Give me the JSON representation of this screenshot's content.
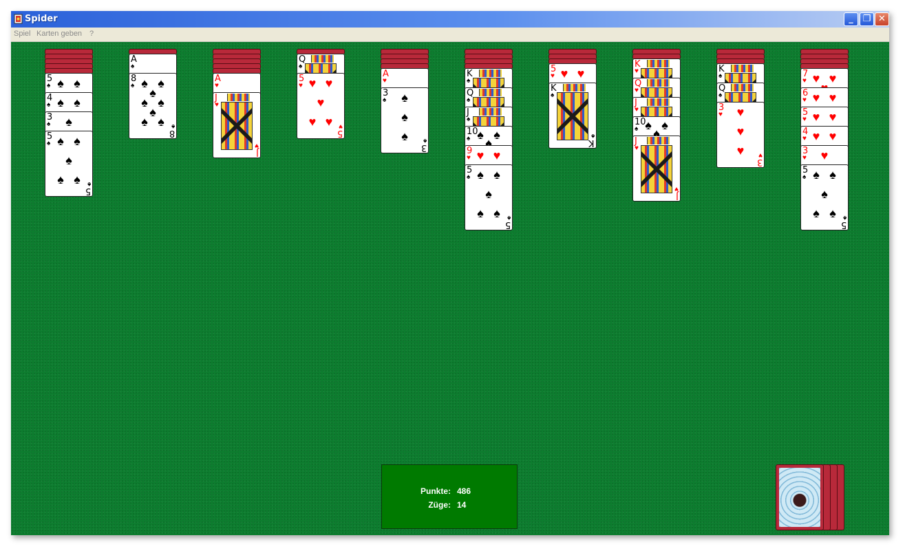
{
  "window": {
    "title": "Spider",
    "controls": {
      "minimize": "_",
      "maximize": "❐",
      "close": "✕"
    }
  },
  "menu": [
    "Spiel",
    "Karten geben",
    "?"
  ],
  "colors": {
    "felt": "#0d7d2f",
    "card_back": "#b8293a",
    "red_suit": "#ff0000",
    "score_panel": "#007a00"
  },
  "tableau": [
    {
      "backs": 5,
      "cards": [
        {
          "rank": "5",
          "suit": "♠",
          "color": "blk"
        },
        {
          "rank": "4",
          "suit": "♠",
          "color": "blk"
        },
        {
          "rank": "3",
          "suit": "♠",
          "color": "blk"
        },
        {
          "rank": "5",
          "suit": "♠",
          "color": "blk"
        }
      ]
    },
    {
      "backs": 1,
      "cards": [
        {
          "rank": "A",
          "suit": "♠",
          "color": "blk"
        },
        {
          "rank": "8",
          "suit": "♠",
          "color": "blk"
        }
      ]
    },
    {
      "backs": 5,
      "cards": [
        {
          "rank": "A",
          "suit": "♥",
          "color": "red"
        },
        {
          "rank": "J",
          "suit": "♥",
          "color": "red"
        }
      ]
    },
    {
      "backs": 1,
      "cards": [
        {
          "rank": "Q",
          "suit": "♠",
          "color": "blk"
        },
        {
          "rank": "5",
          "suit": "♥",
          "color": "red"
        }
      ]
    },
    {
      "backs": 4,
      "cards": [
        {
          "rank": "A",
          "suit": "♥",
          "color": "red"
        },
        {
          "rank": "3",
          "suit": "♠",
          "color": "blk"
        }
      ]
    },
    {
      "backs": 4,
      "cards": [
        {
          "rank": "K",
          "suit": "♠",
          "color": "blk"
        },
        {
          "rank": "Q",
          "suit": "♠",
          "color": "blk"
        },
        {
          "rank": "J",
          "suit": "♠",
          "color": "blk"
        },
        {
          "rank": "10",
          "suit": "♠",
          "color": "blk"
        },
        {
          "rank": "9",
          "suit": "♥",
          "color": "red"
        },
        {
          "rank": "5",
          "suit": "♠",
          "color": "blk"
        }
      ]
    },
    {
      "backs": 3,
      "cards": [
        {
          "rank": "5",
          "suit": "♥",
          "color": "red"
        },
        {
          "rank": "K",
          "suit": "♠",
          "color": "blk"
        }
      ]
    },
    {
      "backs": 2,
      "cards": [
        {
          "rank": "K",
          "suit": "♥",
          "color": "red"
        },
        {
          "rank": "Q",
          "suit": "♥",
          "color": "red"
        },
        {
          "rank": "J",
          "suit": "♥",
          "color": "red"
        },
        {
          "rank": "10",
          "suit": "♠",
          "color": "blk"
        },
        {
          "rank": "J",
          "suit": "♥",
          "color": "red"
        }
      ]
    },
    {
      "backs": 3,
      "cards": [
        {
          "rank": "K",
          "suit": "♠",
          "color": "blk"
        },
        {
          "rank": "Q",
          "suit": "♠",
          "color": "blk"
        },
        {
          "rank": "3",
          "suit": "♥",
          "color": "red"
        }
      ]
    },
    {
      "backs": 4,
      "cards": [
        {
          "rank": "7",
          "suit": "♥",
          "color": "red"
        },
        {
          "rank": "6",
          "suit": "♥",
          "color": "red"
        },
        {
          "rank": "5",
          "suit": "♥",
          "color": "red"
        },
        {
          "rank": "4",
          "suit": "♥",
          "color": "red"
        },
        {
          "rank": "3",
          "suit": "♥",
          "color": "red"
        },
        {
          "rank": "5",
          "suit": "♠",
          "color": "blk"
        }
      ]
    }
  ],
  "score": {
    "points_label": "Punkte:",
    "points": "486",
    "moves_label": "Züge:",
    "moves": "14"
  },
  "stock": {
    "remaining_deals": 4
  }
}
